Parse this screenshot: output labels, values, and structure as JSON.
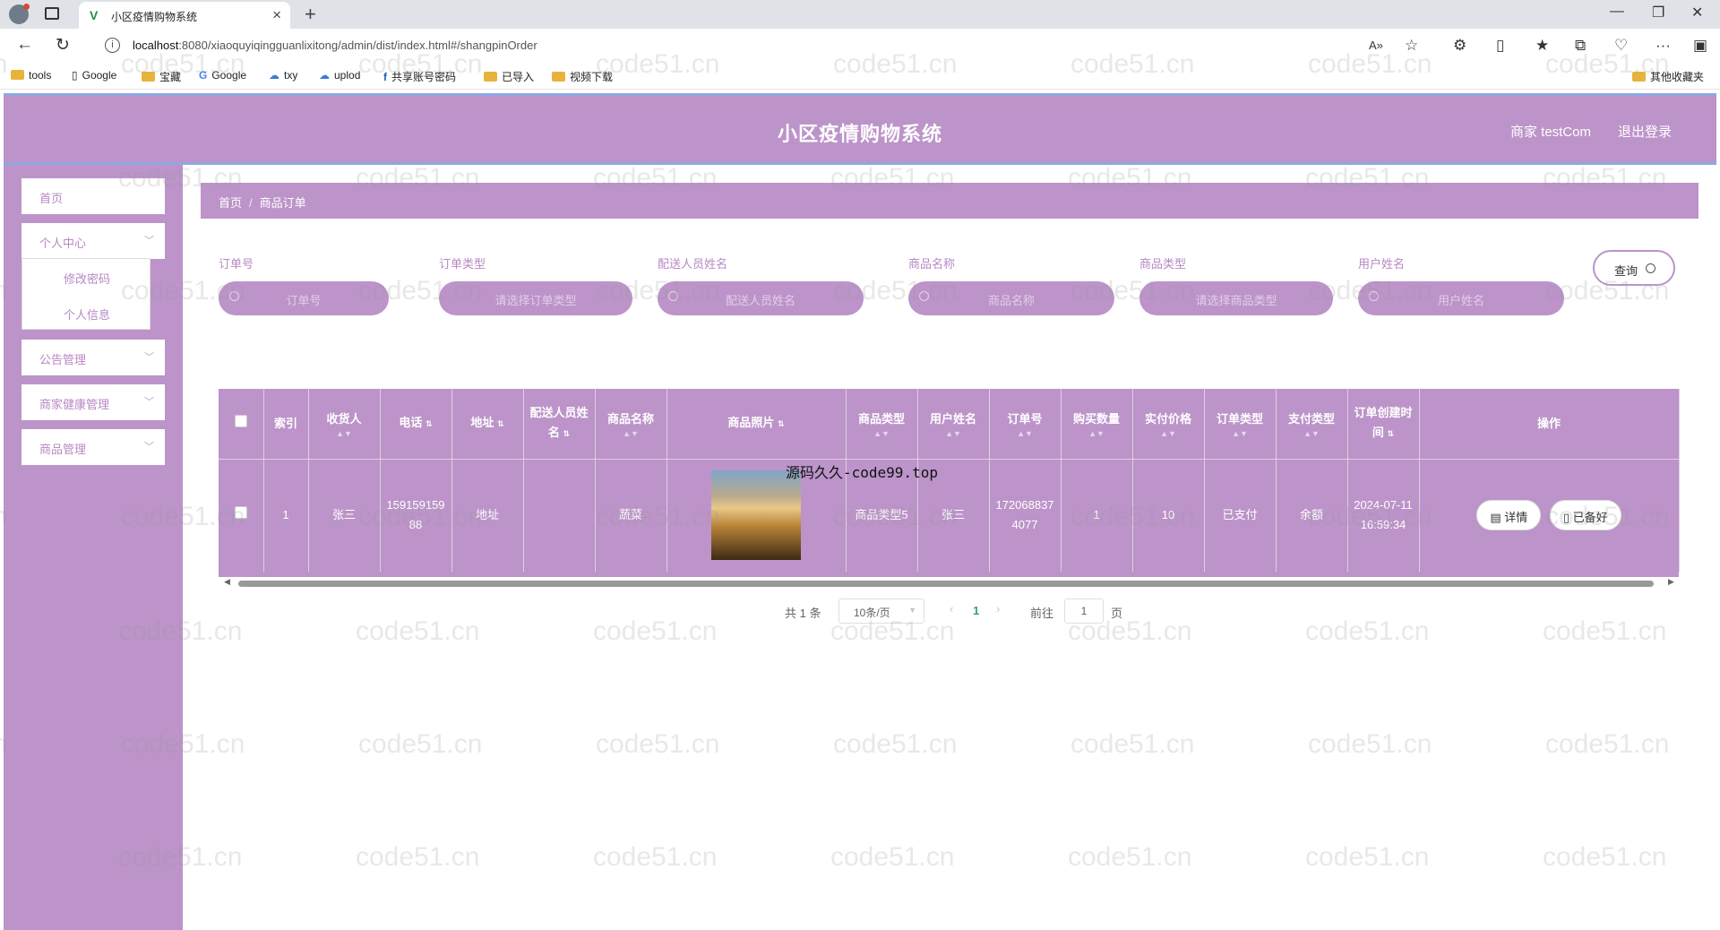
{
  "browser": {
    "tab_title": "小区疫情购物系统",
    "url_host": "localhost",
    "url_path": ":8080/xiaoquyiqingguanlixitong/admin/dist/index.html#/shangpinOrder",
    "bookmarks": [
      "tools",
      "Google",
      "宝藏",
      "Google",
      "txy",
      "uplod",
      "共享账号密码",
      "已导入",
      "视频下载",
      "其他收藏夹"
    ]
  },
  "header": {
    "title": "小区疫情购物系统",
    "user": "商家 testCom",
    "logout": "退出登录"
  },
  "sidebar": {
    "items": [
      {
        "label": "首页"
      },
      {
        "label": "个人中心"
      },
      {
        "label": "公告管理"
      },
      {
        "label": "商家健康管理"
      },
      {
        "label": "商品管理"
      }
    ],
    "submenu": [
      "修改密码",
      "个人信息"
    ]
  },
  "breadcrumb": {
    "home": "首页",
    "current": "商品订单"
  },
  "filters": [
    {
      "label": "订单号",
      "placeholder": "订单号"
    },
    {
      "label": "订单类型",
      "placeholder": "请选择订单类型"
    },
    {
      "label": "配送人员姓名",
      "placeholder": "配送人员姓名"
    },
    {
      "label": "商品名称",
      "placeholder": "商品名称"
    },
    {
      "label": "商品类型",
      "placeholder": "请选择商品类型"
    },
    {
      "label": "用户姓名",
      "placeholder": "用户姓名"
    }
  ],
  "query_button": "查询",
  "table": {
    "columns": [
      "索引",
      "收货人",
      "电话",
      "地址",
      "配送人员姓名",
      "商品名称",
      "商品照片",
      "商品类型",
      "用户姓名",
      "订单号",
      "购买数量",
      "实付价格",
      "订单类型",
      "支付类型",
      "订单创建时间",
      "操作"
    ],
    "rows": [
      {
        "index": "1",
        "receiver": "张三",
        "phone": "15915915988",
        "address": "地址",
        "courier": "",
        "product": "蔬菜",
        "product_type": "商品类型5",
        "user": "张三",
        "order_no": "1720688374077",
        "quantity": "1",
        "price": "10",
        "order_type": "已支付",
        "pay_type": "余额",
        "created": "2024-07-11 16:59:34",
        "actions": [
          "详情",
          "已备好"
        ]
      }
    ]
  },
  "image_caption": "源码久久-code99.top",
  "pagination": {
    "total": "共 1 条",
    "page_size": "10条/页",
    "current": "1",
    "goto_label": "前往",
    "goto_value": "1",
    "page_unit": "页"
  },
  "watermark_text": "code51.cn"
}
